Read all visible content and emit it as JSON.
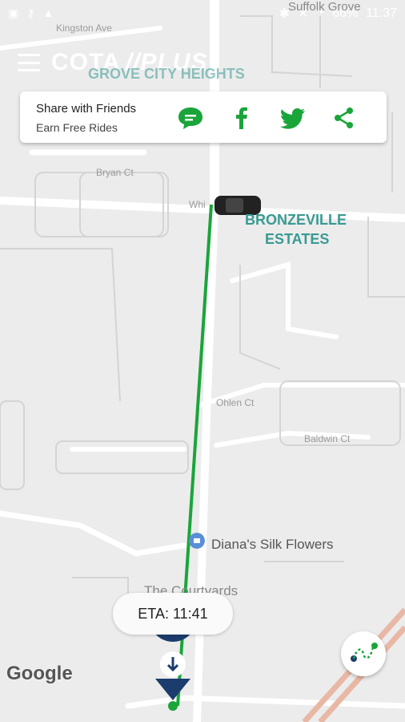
{
  "status_bar": {
    "battery": "66%",
    "time": "11:37"
  },
  "app": {
    "logo_main": "COTA",
    "logo_plus": "PLUS"
  },
  "share_card": {
    "title": "Share with Friends",
    "subtitle": "Earn Free Rides",
    "buttons": [
      "chat-icon",
      "facebook-icon",
      "twitter-icon",
      "share-icon"
    ],
    "accent_color": "#1aa53a"
  },
  "map": {
    "neighborhoods": [
      "GROVE CITY HEIGHTS",
      "BRONZEVILLE",
      "ESTATES"
    ],
    "top_label": "Suffolk Grove",
    "streets": [
      "Kingston Ave",
      "Bryan Ct",
      "Whi",
      "Ohlen Ct",
      "Baldwin Ct"
    ],
    "poi": "Diana's Silk Flowers",
    "poi2": "The Courtyards",
    "route_color": "#1aa53a"
  },
  "eta": {
    "label": "ETA: 11:41"
  },
  "google_logo": "Google"
}
